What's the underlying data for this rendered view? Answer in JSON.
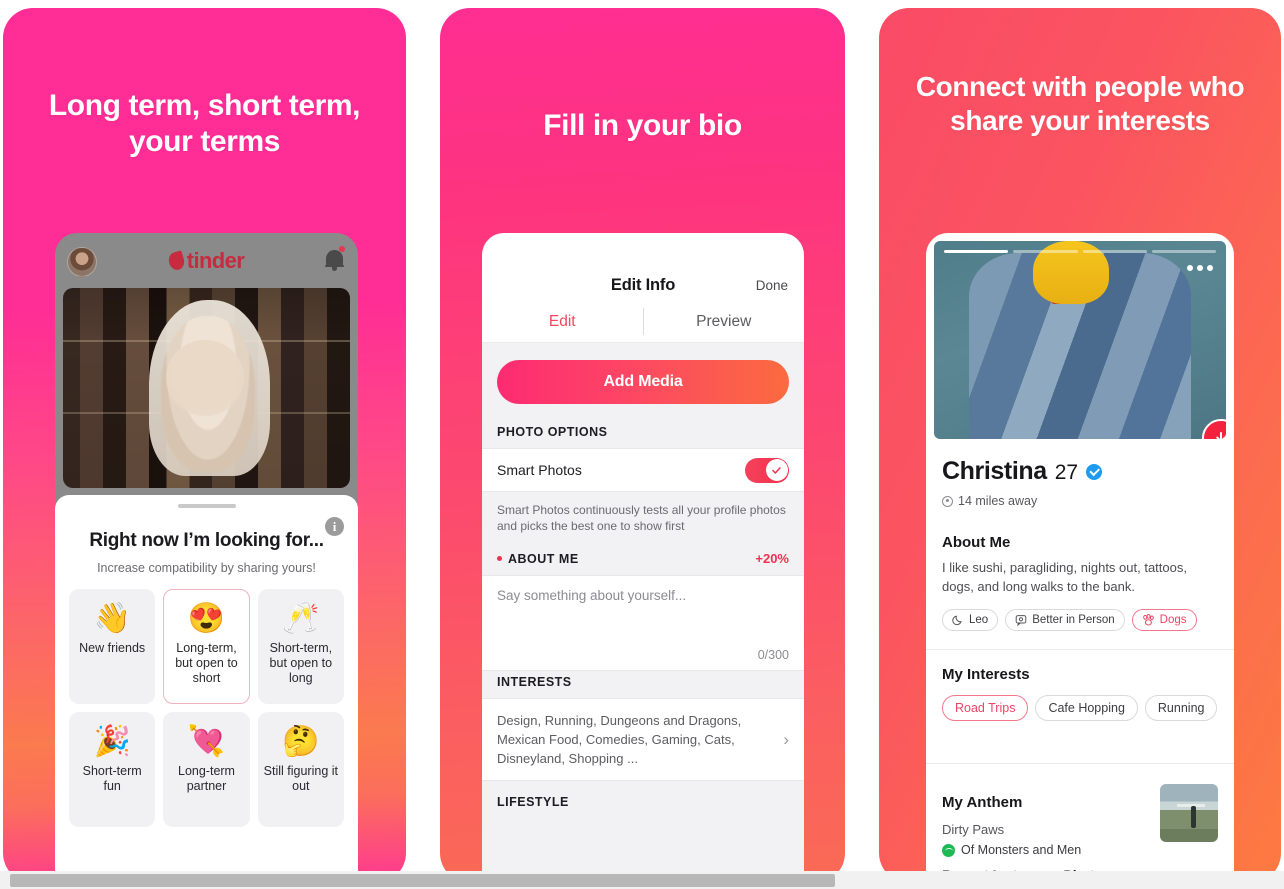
{
  "colors": {
    "pink": "#FF2D95",
    "red": "#F0314F",
    "orange": "#FB7A4E",
    "accent_chip": "#EE4466",
    "verified_blue": "#1D9BF0",
    "spotify_green": "#1DB954"
  },
  "panel1": {
    "title": "Long term, short term, your terms",
    "app": {
      "logo_text": "tinder",
      "avatar_icon": "user-avatar",
      "flame_icon": "tinder-flame-icon",
      "bell_icon": "notification-bell-icon"
    },
    "sheet": {
      "info_icon": "info-icon",
      "heading": "Right now I’m looking for...",
      "subheading": "Increase compatibility by sharing yours!",
      "options": [
        {
          "emoji": "👋",
          "label": "New friends",
          "selected": false
        },
        {
          "emoji": "😍",
          "label": "Long-term, but open to short",
          "selected": true
        },
        {
          "emoji": "🥂",
          "label": "Short-term, but open to long",
          "selected": false
        },
        {
          "emoji": "🎉",
          "label": "Short-term fun",
          "selected": false
        },
        {
          "emoji": "💘",
          "label": "Long-term partner",
          "selected": false
        },
        {
          "emoji": "🤔",
          "label": "Still figuring it out",
          "selected": false
        }
      ]
    }
  },
  "panel2": {
    "title": "Fill in your bio",
    "nav": {
      "title": "Edit Info",
      "done_label": "Done"
    },
    "tabs": [
      {
        "label": "Edit",
        "active": true
      },
      {
        "label": "Preview",
        "active": false
      }
    ],
    "add_media_label": "Add Media",
    "photo_options": {
      "header": "PHOTO OPTIONS",
      "row_label": "Smart Photos",
      "toggle_on": true,
      "helper": "Smart Photos continuously tests all your profile photos and picks the best one to show first"
    },
    "about_me": {
      "header": "ABOUT ME",
      "percent": "+20%",
      "placeholder": "Say something about yourself...",
      "counter": "0/300"
    },
    "interests": {
      "header": "INTERESTS",
      "value": "Design, Running, Dungeons and Dragons, Mexican Food, Comedies, Gaming, Cats, Disneyland, Shopping ...",
      "chevron_icon": "chevron-right-icon"
    },
    "lifestyle_header": "LIFESTYLE"
  },
  "panel3": {
    "title": "Connect with people who share your interests",
    "card": {
      "photo_dots_icon": "more-options-icon",
      "down_icon": "chevron-down-circle-icon",
      "name": "Christina",
      "age": "27",
      "verified_icon": "verified-badge-icon",
      "distance_icon": "location-pin-icon",
      "distance": "14 miles away",
      "about_title": "About Me",
      "about_text": "I like sushi, paragliding, nights out, tattoos, dogs, and long walks to the bank.",
      "attribute_chips": [
        {
          "label": "Leo",
          "icon": "moon-zodiac-icon",
          "highlighted": false
        },
        {
          "label": "Better in Person",
          "icon": "chat-bubble-icon",
          "highlighted": false
        },
        {
          "label": "Dogs",
          "icon": "paw-print-icon",
          "highlighted": true
        }
      ],
      "interests_title": "My Interests",
      "interest_chips": [
        {
          "label": "Road Trips",
          "matched": true
        },
        {
          "label": "Cafe Hopping",
          "matched": false
        },
        {
          "label": "Running",
          "matched": false
        }
      ],
      "anthem_title": "My Anthem",
      "anthem_track": "Dirty Paws",
      "anthem_artist": "Of Monsters and Men",
      "anthem_icon": "spotify-icon",
      "instagram_title": "Recent Instagram Photos"
    }
  }
}
